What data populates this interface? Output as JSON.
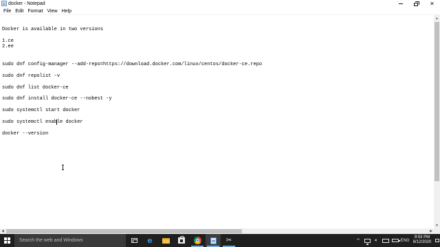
{
  "window": {
    "title": "docker - Notepad",
    "app_icon": "notepad-icon",
    "controls": {
      "minimize_icon": "minimize-icon",
      "maximize_icon": "maximize-icon",
      "close_glyph": "✕"
    }
  },
  "menu": {
    "items": [
      "File",
      "Edit",
      "Format",
      "View",
      "Help"
    ]
  },
  "editor": {
    "lines": [
      "Docker is available in two versions",
      "1.ce",
      "2.ee",
      "sudo dnf config-manager --add-repo=https://download.docker.com/linux/centos/docker-ce.repo",
      "sudo dnf repolist -v",
      "sudo dnf list docker-ce",
      "sudo dnf install docker-ce --nobest -y",
      "sudo systemctl start docker",
      "sudo systemctl enable docker",
      "docker --version"
    ],
    "cursor_line": 9,
    "pointer": "i-beam-cursor"
  },
  "scrollbars": {
    "up_arrow": "▲",
    "down_arrow": "▼",
    "left_arrow": "◀",
    "right_arrow": "▶"
  },
  "taskbar": {
    "search_placeholder": "Search the web and Windows",
    "apps": [
      {
        "name": "task-view-icon",
        "running": false
      },
      {
        "name": "edge-icon",
        "glyph": "e",
        "running": false
      },
      {
        "name": "file-explorer-icon",
        "running": false
      },
      {
        "name": "store-icon",
        "running": false
      },
      {
        "name": "chrome-icon",
        "running": true
      },
      {
        "name": "notepad-icon",
        "running": true,
        "active": true
      },
      {
        "name": "snipping-tool-icon",
        "glyph": "✂",
        "running": true
      }
    ],
    "tray": {
      "chevron": "^",
      "volume_glyph": "🔈︎",
      "language": "ENG"
    },
    "clock": {
      "time": "9:53 PM",
      "date": "8/12/2020"
    }
  },
  "colors": {
    "taskbar_bg": "#1f1f1f",
    "search_bg": "#3a3a3a",
    "accent": "#7aa7d6",
    "scroll_thumb": "#c1c1c1"
  }
}
